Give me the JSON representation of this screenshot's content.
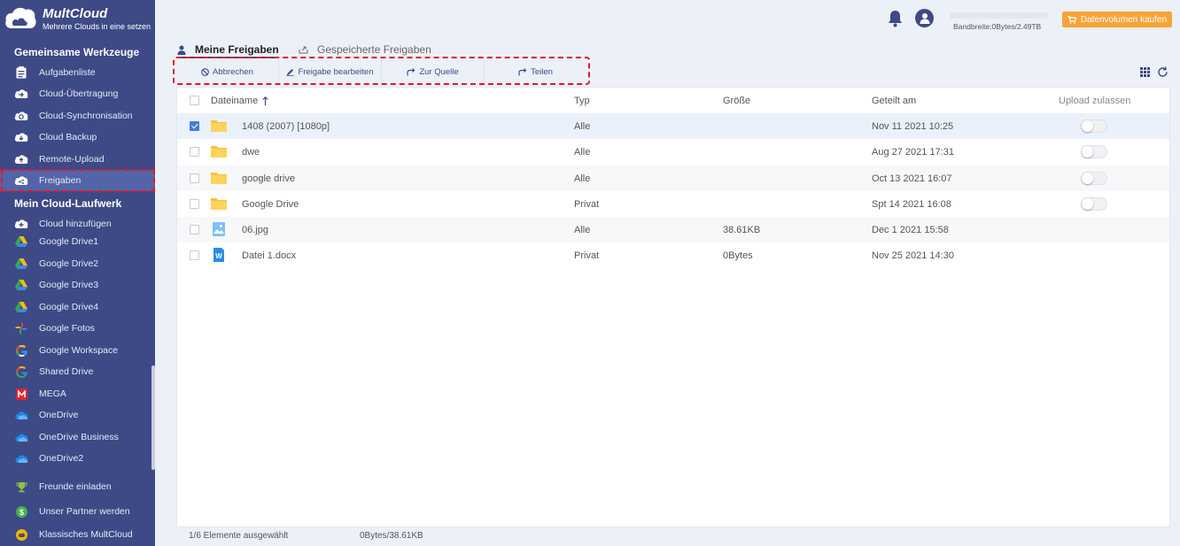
{
  "brand": {
    "title": "MultCloud",
    "subtitle": "Mehrere Clouds in eine setzen"
  },
  "sidebar": {
    "section1_title": "Gemeinsame Werkzeuge",
    "tools": [
      {
        "label": "Aufgabenliste",
        "icon": "task-list-icon"
      },
      {
        "label": "Cloud-Übertragung",
        "icon": "cloud-transfer-icon"
      },
      {
        "label": "Cloud-Synchronisation",
        "icon": "cloud-sync-icon"
      },
      {
        "label": "Cloud Backup",
        "icon": "cloud-backup-icon"
      },
      {
        "label": "Remote-Upload",
        "icon": "remote-upload-icon"
      },
      {
        "label": "Freigaben",
        "icon": "share-cloud-icon"
      }
    ],
    "section2_title": "Mein Cloud-Laufwerk",
    "drives": [
      {
        "label": "Cloud hinzufügen",
        "icon": "add-cloud-icon"
      },
      {
        "label": "Google Drive1",
        "icon": "google-drive-icon"
      },
      {
        "label": "Google Drive2",
        "icon": "google-drive-icon"
      },
      {
        "label": "Google Drive3",
        "icon": "google-drive-icon"
      },
      {
        "label": "Google Drive4",
        "icon": "google-drive-icon"
      },
      {
        "label": "Google Fotos",
        "icon": "google-photos-icon"
      },
      {
        "label": "Google Workspace",
        "icon": "google-workspace-icon"
      },
      {
        "label": "Shared Drive",
        "icon": "shared-drive-icon"
      },
      {
        "label": "MEGA",
        "icon": "mega-icon"
      },
      {
        "label": "OneDrive",
        "icon": "onedrive-icon"
      },
      {
        "label": "OneDrive Business",
        "icon": "onedrive-icon"
      },
      {
        "label": "OneDrive2",
        "icon": "onedrive-icon"
      }
    ],
    "extras": [
      {
        "label": "Freunde einladen",
        "icon": "trophy-icon"
      },
      {
        "label": "Unser Partner werden",
        "icon": "dollar-icon"
      },
      {
        "label": "Klassisches MultCloud",
        "icon": "classic-icon"
      }
    ]
  },
  "header": {
    "bandwidth": "Bandbreite:0Bytes/2.49TB",
    "bandwidth_used_fraction": 0.0,
    "buy_label": "Datenvolumen kaufen"
  },
  "tabs": [
    {
      "label": "Meine Freigaben",
      "active": true
    },
    {
      "label": "Gespeicherte Freigaben",
      "active": false
    }
  ],
  "toolbar": [
    {
      "label": "Abbrechen",
      "icon": "cancel-icon"
    },
    {
      "label": "Freigabe bearbeiten",
      "icon": "edit-icon"
    },
    {
      "label": "Zur Quelle",
      "icon": "goto-source-icon"
    },
    {
      "label": "Teilen",
      "icon": "share-icon"
    }
  ],
  "table": {
    "columns": {
      "name": "Dateiname",
      "type": "Typ",
      "size": "Größe",
      "shared": "Geteilt am",
      "upload": "Upload zulassen"
    },
    "rows": [
      {
        "name": "1408 (2007) [1080p]",
        "kind": "folder",
        "type": "Alle",
        "size": "",
        "shared": "Nov 11 2021 10:25",
        "upload": false,
        "has_toggle": true,
        "selected": true
      },
      {
        "name": "dwe",
        "kind": "folder",
        "type": "Alle",
        "size": "",
        "shared": "Aug 27 2021 17:31",
        "upload": false,
        "has_toggle": true,
        "selected": false
      },
      {
        "name": "google drive",
        "kind": "folder",
        "type": "Alle",
        "size": "",
        "shared": "Oct 13 2021 16:07",
        "upload": false,
        "has_toggle": true,
        "selected": false
      },
      {
        "name": "Google Drive",
        "kind": "folder",
        "type": "Privat",
        "size": "",
        "shared": "Spt 14 2021 16:08",
        "upload": false,
        "has_toggle": true,
        "selected": false
      },
      {
        "name": "06.jpg",
        "kind": "image",
        "type": "Alle",
        "size": "38.61KB",
        "shared": "Dec 1 2021 15:58",
        "upload": false,
        "has_toggle": false,
        "selected": false
      },
      {
        "name": "Datei 1.docx",
        "kind": "word",
        "type": "Privat",
        "size": "0Bytes",
        "shared": "Nov 25 2021 14:30",
        "upload": false,
        "has_toggle": false,
        "selected": false
      }
    ]
  },
  "footer": {
    "selection": "1/6 Elemente ausgewählt",
    "size": "0Bytes/38.61KB"
  },
  "colors": {
    "sidebar": "#3d4a86",
    "accent": "#f7a43a",
    "highlight": "#e0162b"
  }
}
